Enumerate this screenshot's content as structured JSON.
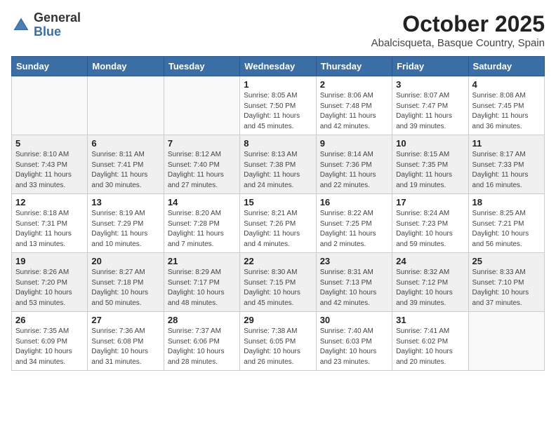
{
  "header": {
    "logo_general": "General",
    "logo_blue": "Blue",
    "title": "October 2025",
    "subtitle": "Abalcisqueta, Basque Country, Spain"
  },
  "weekdays": [
    "Sunday",
    "Monday",
    "Tuesday",
    "Wednesday",
    "Thursday",
    "Friday",
    "Saturday"
  ],
  "weeks": [
    {
      "shaded": false,
      "days": [
        {
          "num": "",
          "info": ""
        },
        {
          "num": "",
          "info": ""
        },
        {
          "num": "",
          "info": ""
        },
        {
          "num": "1",
          "info": "Sunrise: 8:05 AM\nSunset: 7:50 PM\nDaylight: 11 hours and 45 minutes."
        },
        {
          "num": "2",
          "info": "Sunrise: 8:06 AM\nSunset: 7:48 PM\nDaylight: 11 hours and 42 minutes."
        },
        {
          "num": "3",
          "info": "Sunrise: 8:07 AM\nSunset: 7:47 PM\nDaylight: 11 hours and 39 minutes."
        },
        {
          "num": "4",
          "info": "Sunrise: 8:08 AM\nSunset: 7:45 PM\nDaylight: 11 hours and 36 minutes."
        }
      ]
    },
    {
      "shaded": true,
      "days": [
        {
          "num": "5",
          "info": "Sunrise: 8:10 AM\nSunset: 7:43 PM\nDaylight: 11 hours and 33 minutes."
        },
        {
          "num": "6",
          "info": "Sunrise: 8:11 AM\nSunset: 7:41 PM\nDaylight: 11 hours and 30 minutes."
        },
        {
          "num": "7",
          "info": "Sunrise: 8:12 AM\nSunset: 7:40 PM\nDaylight: 11 hours and 27 minutes."
        },
        {
          "num": "8",
          "info": "Sunrise: 8:13 AM\nSunset: 7:38 PM\nDaylight: 11 hours and 24 minutes."
        },
        {
          "num": "9",
          "info": "Sunrise: 8:14 AM\nSunset: 7:36 PM\nDaylight: 11 hours and 22 minutes."
        },
        {
          "num": "10",
          "info": "Sunrise: 8:15 AM\nSunset: 7:35 PM\nDaylight: 11 hours and 19 minutes."
        },
        {
          "num": "11",
          "info": "Sunrise: 8:17 AM\nSunset: 7:33 PM\nDaylight: 11 hours and 16 minutes."
        }
      ]
    },
    {
      "shaded": false,
      "days": [
        {
          "num": "12",
          "info": "Sunrise: 8:18 AM\nSunset: 7:31 PM\nDaylight: 11 hours and 13 minutes."
        },
        {
          "num": "13",
          "info": "Sunrise: 8:19 AM\nSunset: 7:29 PM\nDaylight: 11 hours and 10 minutes."
        },
        {
          "num": "14",
          "info": "Sunrise: 8:20 AM\nSunset: 7:28 PM\nDaylight: 11 hours and 7 minutes."
        },
        {
          "num": "15",
          "info": "Sunrise: 8:21 AM\nSunset: 7:26 PM\nDaylight: 11 hours and 4 minutes."
        },
        {
          "num": "16",
          "info": "Sunrise: 8:22 AM\nSunset: 7:25 PM\nDaylight: 11 hours and 2 minutes."
        },
        {
          "num": "17",
          "info": "Sunrise: 8:24 AM\nSunset: 7:23 PM\nDaylight: 10 hours and 59 minutes."
        },
        {
          "num": "18",
          "info": "Sunrise: 8:25 AM\nSunset: 7:21 PM\nDaylight: 10 hours and 56 minutes."
        }
      ]
    },
    {
      "shaded": true,
      "days": [
        {
          "num": "19",
          "info": "Sunrise: 8:26 AM\nSunset: 7:20 PM\nDaylight: 10 hours and 53 minutes."
        },
        {
          "num": "20",
          "info": "Sunrise: 8:27 AM\nSunset: 7:18 PM\nDaylight: 10 hours and 50 minutes."
        },
        {
          "num": "21",
          "info": "Sunrise: 8:29 AM\nSunset: 7:17 PM\nDaylight: 10 hours and 48 minutes."
        },
        {
          "num": "22",
          "info": "Sunrise: 8:30 AM\nSunset: 7:15 PM\nDaylight: 10 hours and 45 minutes."
        },
        {
          "num": "23",
          "info": "Sunrise: 8:31 AM\nSunset: 7:13 PM\nDaylight: 10 hours and 42 minutes."
        },
        {
          "num": "24",
          "info": "Sunrise: 8:32 AM\nSunset: 7:12 PM\nDaylight: 10 hours and 39 minutes."
        },
        {
          "num": "25",
          "info": "Sunrise: 8:33 AM\nSunset: 7:10 PM\nDaylight: 10 hours and 37 minutes."
        }
      ]
    },
    {
      "shaded": false,
      "days": [
        {
          "num": "26",
          "info": "Sunrise: 7:35 AM\nSunset: 6:09 PM\nDaylight: 10 hours and 34 minutes."
        },
        {
          "num": "27",
          "info": "Sunrise: 7:36 AM\nSunset: 6:08 PM\nDaylight: 10 hours and 31 minutes."
        },
        {
          "num": "28",
          "info": "Sunrise: 7:37 AM\nSunset: 6:06 PM\nDaylight: 10 hours and 28 minutes."
        },
        {
          "num": "29",
          "info": "Sunrise: 7:38 AM\nSunset: 6:05 PM\nDaylight: 10 hours and 26 minutes."
        },
        {
          "num": "30",
          "info": "Sunrise: 7:40 AM\nSunset: 6:03 PM\nDaylight: 10 hours and 23 minutes."
        },
        {
          "num": "31",
          "info": "Sunrise: 7:41 AM\nSunset: 6:02 PM\nDaylight: 10 hours and 20 minutes."
        },
        {
          "num": "",
          "info": ""
        }
      ]
    }
  ]
}
